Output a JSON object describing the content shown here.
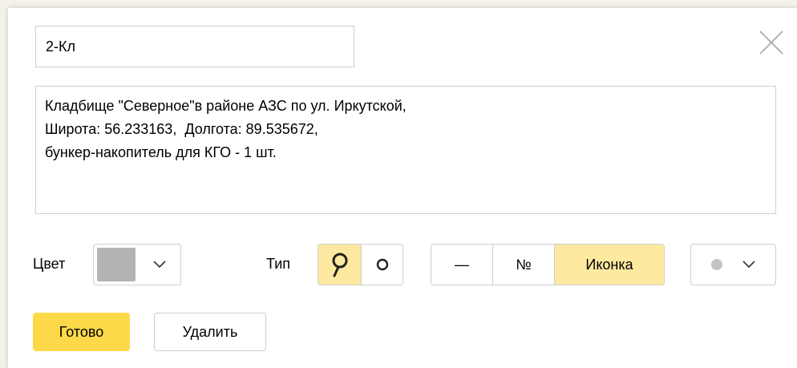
{
  "form": {
    "name_value": "2-Кл",
    "description": "Кладбище \"Северное\"в районе АЗС по ул. Иркутской,\nШирота: 56.233163,  Долгота: 89.535672,\nбункер-накопитель для КГО - 1 шт."
  },
  "color": {
    "label": "Цвет",
    "selected_swatch": "#b3b3b3"
  },
  "type": {
    "label": "Тип",
    "options": [
      "pin-icon",
      "circle-icon"
    ],
    "selected": "pin-icon"
  },
  "content_mode": {
    "options": [
      "—",
      "№",
      "Иконка"
    ],
    "selected": "Иконка"
  },
  "icon_select": {
    "dot_color": "#c4c4c4"
  },
  "actions": {
    "done_label": "Готово",
    "delete_label": "Удалить"
  },
  "colors": {
    "accent": "#fdd94a",
    "active_segment": "#fde9a0",
    "border": "#cfcfcf"
  }
}
